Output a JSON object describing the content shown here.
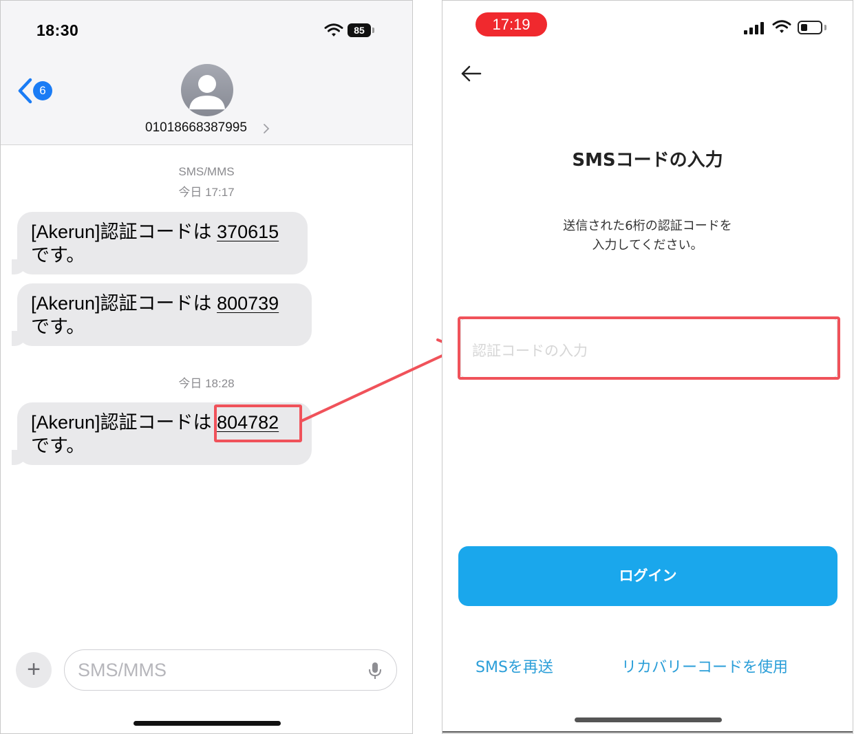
{
  "messages_screen": {
    "status_time": "18:30",
    "battery_level": "85",
    "back_badge_count": "6",
    "contact_number": "01018668387995",
    "service_label": "SMS/MMS",
    "first_date": "今日 17:17",
    "second_date": "今日 18:28",
    "messages": [
      {
        "prefix": "[Akerun]認証コードは ",
        "code": "370615",
        "suffix": "です。"
      },
      {
        "prefix": "[Akerun]認証コードは ",
        "code": "800739",
        "suffix": "です。"
      },
      {
        "prefix": "[Akerun]認証コードは ",
        "code": "804782",
        "suffix": "です。"
      }
    ],
    "input_placeholder": "SMS/MMS",
    "plus_label": "+"
  },
  "app_screen": {
    "status_time": "17:19",
    "title": "SMSコードの入力",
    "instruction_line1": "送信された6桁の認証コードを",
    "instruction_line2": "入力してください。",
    "code_input_placeholder": "認証コードの入力",
    "login_button": "ログイン",
    "resend_link": "SMSを再送",
    "recovery_link": "リカバリーコードを使用"
  },
  "colors": {
    "highlight": "#f0525a",
    "ios_blue": "#1a7cf5",
    "app_button": "#1aa7ec",
    "app_link": "#2a9ed8",
    "recording_pill": "#f0292e",
    "bubble_gray": "#e9e9eb"
  },
  "icons": [
    "wifi-icon",
    "battery-icon",
    "chevron-left-icon",
    "person-icon",
    "chevron-right-icon",
    "plus-icon",
    "microphone-icon",
    "cellular-signal-icon",
    "arrow-left-icon"
  ]
}
